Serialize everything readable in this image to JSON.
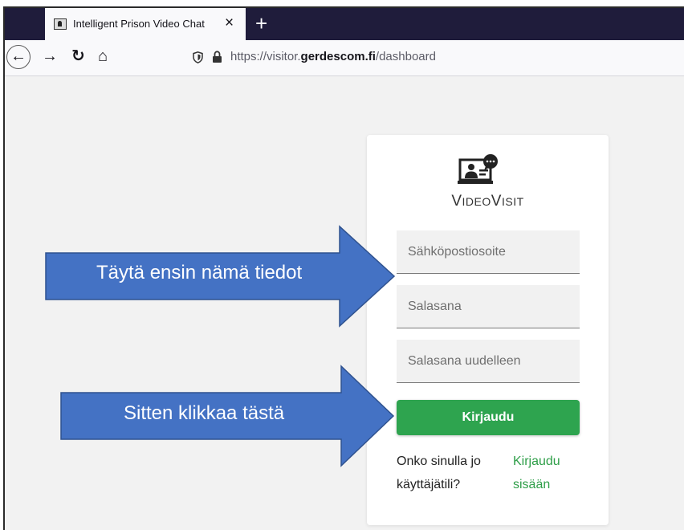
{
  "browser": {
    "tab_title": "Intelligent Prison Video Chat",
    "tab_close": "×",
    "new_tab": "+",
    "url_prefix": "https://visitor.",
    "url_domain": "gerdescom.fi",
    "url_path": "/dashboard",
    "icons": {
      "back": "back-arrow-icon",
      "forward": "forward-arrow-icon",
      "reload": "reload-icon",
      "home": "home-icon",
      "shield": "shield-icon",
      "lock": "lock-icon",
      "favicon": "prisoner-favicon-icon"
    }
  },
  "login": {
    "brand_first": "V",
    "brand_rest1": "IDEO",
    "brand_second": "V",
    "brand_rest2": "ISIT",
    "email_placeholder": "Sähköpostiosoite",
    "password_placeholder": "Salasana",
    "password_repeat_placeholder": "Salasana uudelleen",
    "login_button": "Kirjaudu",
    "account_question": "Onko sinulla jo käyttäjätili?",
    "signin_link": "Kirjaudu sisään",
    "colors": {
      "button": "#2ea44f",
      "link": "#2e9e48"
    }
  },
  "callouts": {
    "first": "Täytä ensin nämä tiedot",
    "second": "Sitten klikkaa tästä",
    "color": "#4472c4"
  }
}
